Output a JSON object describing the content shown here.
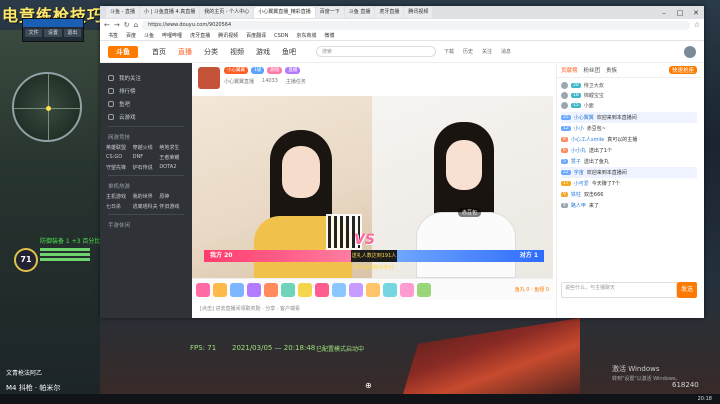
{
  "overlay": {
    "title": "电竞练枪技巧",
    "mini_buttons": [
      "文件",
      "设置",
      "退出"
    ],
    "hp_value": "71",
    "hp_label": "防御装备 1 +3 百分比",
    "bottom_name": "文青枪法阿乙",
    "bottom_weapon": "M4 抖枪 · 帕米尔",
    "fps": "FPS: 71",
    "date": "2021/03/05 — 20:18:48",
    "debug": "已配置模式启动中",
    "activate_title": "激活 Windows",
    "activate_sub": "转到\"设置\"以激活 Windows。",
    "watermark": "618240",
    "clock": "20:18"
  },
  "browser": {
    "tabs": [
      "斗鱼 - 直播",
      "小 | 斗鱼直播 4.真直播",
      "我的主页 - 个人中心",
      "小心翼翼直播_精彩直播",
      "百度一下",
      "斗鱼 直播",
      "虎牙直播",
      "腾讯视频",
      "我的主页"
    ],
    "url": "https://www.douyu.com/9020564",
    "bookmarks": [
      "书签",
      "百度",
      "斗鱼",
      "哔哩哔哩",
      "虎牙直播",
      "腾讯视频",
      "百度翻译",
      "CSDN",
      "京东商城",
      "微博"
    ]
  },
  "douyu": {
    "logo": "斗鱼",
    "nav": [
      "首页",
      "直播",
      "分类",
      "视频",
      "游戏",
      "鱼吧"
    ],
    "search_placeholder": "搜索",
    "icons": [
      "下载",
      "历史",
      "关注",
      "消息"
    ]
  },
  "leftnav": {
    "items": [
      "我的关注",
      "排行榜",
      "鱼吧",
      "云游戏"
    ],
    "section1": "网游竞技",
    "grid1": [
      "英雄联盟",
      "穿越火线",
      "绝地求生",
      "CS:GO",
      "DNF",
      "王者荣耀",
      "守望先锋",
      "炉石传说",
      "DOTA2"
    ],
    "section2": "单机热游",
    "grid2": [
      "主机游戏",
      "我的世界",
      "原神",
      "七日杀",
      "逃离塔科夫",
      "怀旧游戏"
    ],
    "section3": "手游休闲"
  },
  "room": {
    "badges": [
      "小心翼翼",
      "1级",
      "颜值",
      "直播"
    ],
    "line2": [
      "小心翼翼直播",
      "14033",
      "主播任务"
    ],
    "pk_left": "我方 20",
    "pk_mid": "送礼人数达到191人 即可获得额外积分",
    "pk_right": "对方 1",
    "vs": "VS",
    "host_left": "小心翼翼",
    "host_right": "赤豆包",
    "balance": "鱼丸 0 · 鱼翅 0",
    "footer": "[点击] 进去直播间领取奖励 · 分享 · 客户端看"
  },
  "chat": {
    "tabs": [
      "贡献榜",
      "粉丝团",
      "贵族"
    ],
    "rank_btn": "快速抢座",
    "ranks": [
      {
        "lvl": "20",
        "name": "侍卫大叔"
      },
      {
        "lvl": "18",
        "name": "锦鲤宝宝"
      },
      {
        "lvl": "15",
        "name": "小面"
      }
    ],
    "msgs": [
      {
        "lvl": "25",
        "user": "小心翼翼",
        "text": "欢迎来到本直播间"
      },
      {
        "lvl": "12",
        "user": "小小",
        "text": "赤豆包~"
      },
      {
        "lvl": "8",
        "user": "小心工人smile",
        "text": "真可以的主播"
      },
      {
        "lvl": "6",
        "user": "小小丸",
        "text": "送出了1个"
      },
      {
        "lvl": "5",
        "user": "慧子",
        "text": "送出了鱼丸"
      },
      {
        "lvl": "22",
        "user": "宇宙",
        "text": "欢迎来到本直播间"
      },
      {
        "lvl": "17",
        "user": "小可爱",
        "text": "今天赚了7个"
      },
      {
        "lvl": "9",
        "user": "铁柱",
        "text": "双击666"
      },
      {
        "lvl": "4",
        "user": "路人甲",
        "text": "来了"
      }
    ],
    "input_placeholder": "说些什么，与主播聊天",
    "send": "发送"
  }
}
